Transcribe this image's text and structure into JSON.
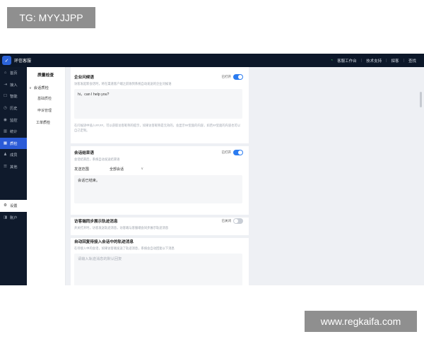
{
  "watermark": {
    "top": "TG: MYYJJPP",
    "bottom": "www.regkaifa.com"
  },
  "app": {
    "title": "环信客服"
  },
  "topbar": {
    "items": [
      "客服工作台",
      "技术支持",
      "探客",
      "查找"
    ]
  },
  "sidebar": {
    "items": [
      {
        "icon": "⌂",
        "label": "首页"
      },
      {
        "icon": "⇥",
        "label": "接入"
      },
      {
        "icon": "☐",
        "label": "智能"
      },
      {
        "icon": "◷",
        "label": "历史"
      },
      {
        "icon": "◉",
        "label": "监控"
      },
      {
        "icon": "▥",
        "label": "统计"
      },
      {
        "icon": "▦",
        "label": "质检"
      },
      {
        "icon": "♟",
        "label": "成员"
      },
      {
        "icon": "☰",
        "label": "其他"
      }
    ],
    "bottom_items": [
      {
        "icon": "⚙",
        "label": "设置"
      },
      {
        "icon": "◨",
        "label": "账户"
      }
    ]
  },
  "subnav": {
    "title": "质量检查",
    "group": "会话质检",
    "items": [
      "基础质检",
      "申诉管理"
    ],
    "item2": "工单质检"
  },
  "cards": {
    "greeting": {
      "title": "企业问候语",
      "desc": "访客发起新会话时，将在渠道客户端之前收到系统自动发送的企业问候语",
      "toggle_label": "已打开",
      "text": "hi，can I help you?",
      "note": "在问候语中插入##,##，可以获取访客昵称的提示，如果访客昵称是无效的，会显示##里面的内容，如若##里面的内容也可以自己定制。"
    },
    "end": {
      "title": "会话结束语",
      "desc": "会话结束后，系统自动发送结束语",
      "toggle_label": "已打开",
      "scope_label": "发送范围",
      "scope_value": "全部会话",
      "text": "会话已结束。"
    },
    "sync": {
      "title": "访客端同步展示轨迹消息",
      "desc": "开关打开时，访客发送轨迹消息，访客端与客服端会同步展示轨迹消息",
      "toggle_label": "已关闭"
    },
    "auto_reply": {
      "title": "自动回复待接入会话中的轨迹消息",
      "desc": "在待接入中的会话，如果访客端发送了轨迹消息，系统会自动回复以下消息",
      "placeholder": "请输入轨迹消息的默认回复"
    }
  }
}
